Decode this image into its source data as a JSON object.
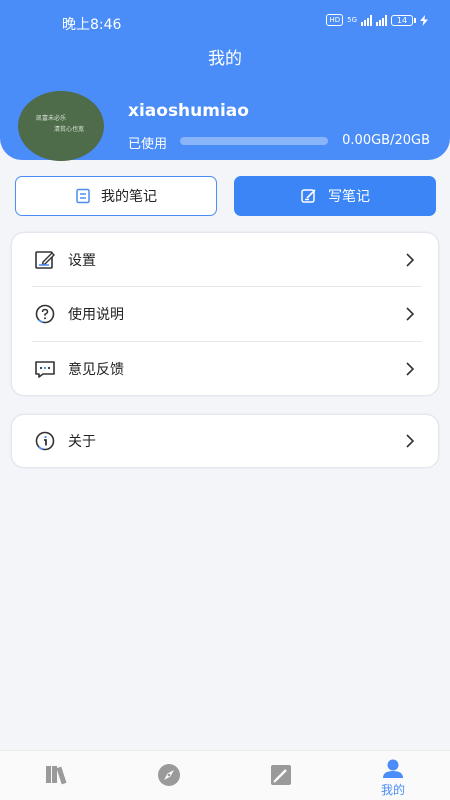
{
  "status_bar": {
    "time": "晚上8:46",
    "hd": "HD",
    "network": "5G",
    "battery": "14"
  },
  "header": {
    "title": "我的",
    "username": "xiaoshumiao",
    "avatar_text_1": "凯富未必乐",
    "avatar_text_2": "清贫心也宽",
    "storage_label": "已使用",
    "storage_value": "0.00GB/20GB",
    "storage_used_fraction": 0.0
  },
  "actions": {
    "my_notes": "我的笔记",
    "write_note": "写笔记"
  },
  "menu": {
    "items": [
      {
        "label": "设置",
        "icon": "edit-square-icon"
      },
      {
        "label": "使用说明",
        "icon": "help-circle-icon"
      },
      {
        "label": "意见反馈",
        "icon": "feedback-chat-icon"
      }
    ],
    "about": {
      "label": "关于",
      "icon": "info-icon"
    }
  },
  "tabbar": {
    "tabs": [
      {
        "icon": "bookshelf-icon",
        "label": ""
      },
      {
        "icon": "compass-icon",
        "label": ""
      },
      {
        "icon": "note-pen-icon",
        "label": ""
      },
      {
        "icon": "profile-icon",
        "label": "我的",
        "active": true
      }
    ]
  },
  "colors": {
    "primary": "#4a8df8",
    "background": "#f3f5f9",
    "inactive_icon": "#9a9a9a"
  }
}
